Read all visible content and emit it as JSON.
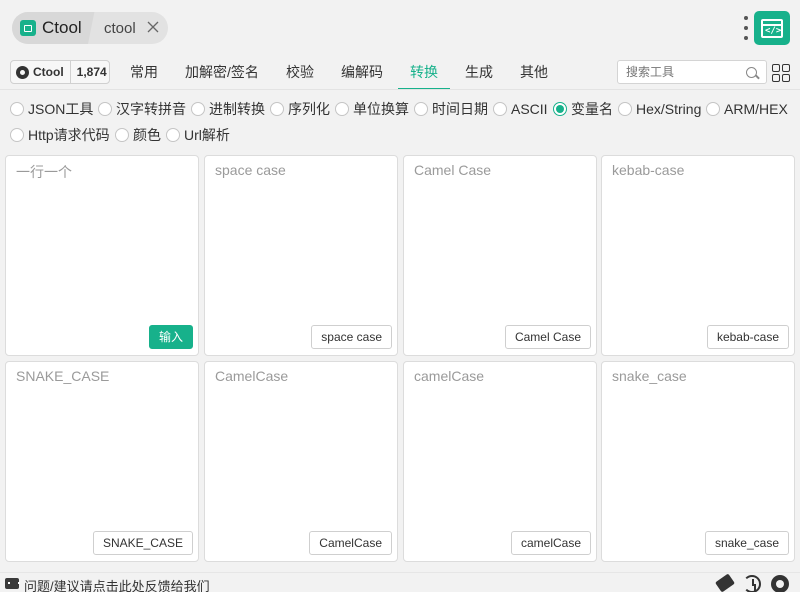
{
  "window": {
    "app_tab": "Ctool",
    "second_tab": "ctool"
  },
  "github": {
    "label": "Ctool",
    "stars": "1,874"
  },
  "nav": {
    "tabs": [
      {
        "label": "常用"
      },
      {
        "label": "加解密/签名"
      },
      {
        "label": "校验"
      },
      {
        "label": "编解码"
      },
      {
        "label": "转换",
        "active": true
      },
      {
        "label": "生成"
      },
      {
        "label": "其他"
      }
    ],
    "search_placeholder": "搜索工具"
  },
  "tools": {
    "options": [
      "JSON工具",
      "汉字转拼音",
      "进制转换",
      "序列化",
      "单位换算",
      "时间日期",
      "ASCII",
      "变量名",
      "Hex/String",
      "ARM/HEX",
      "Http请求代码",
      "颜色",
      "Url解析"
    ],
    "selected": "变量名"
  },
  "panels": [
    {
      "placeholder": "一行一个",
      "button": "输入"
    },
    {
      "placeholder": "space case",
      "button": "space case"
    },
    {
      "placeholder": "Camel Case",
      "button": "Camel Case"
    },
    {
      "placeholder": "kebab-case",
      "button": "kebab-case"
    },
    {
      "placeholder": "SNAKE_CASE",
      "button": "SNAKE_CASE"
    },
    {
      "placeholder": "CamelCase",
      "button": "CamelCase"
    },
    {
      "placeholder": "camelCase",
      "button": "camelCase"
    },
    {
      "placeholder": "snake_case",
      "button": "snake_case"
    }
  ],
  "footer": {
    "feedback": "问题/建议请点击此处反馈给我们"
  },
  "colors": {
    "accent": "#17b18b"
  }
}
